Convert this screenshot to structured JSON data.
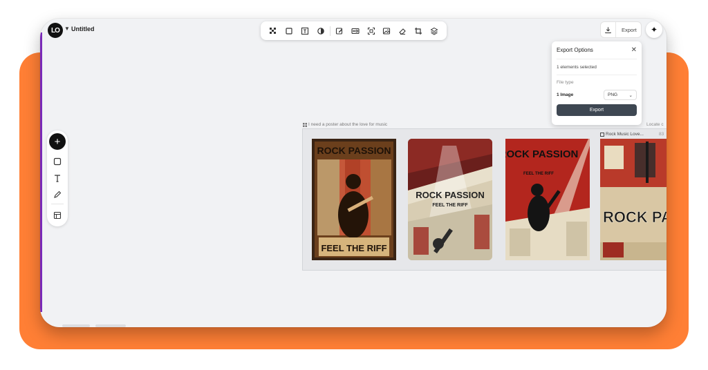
{
  "app": {
    "title": "Untitled",
    "logo": "LO"
  },
  "toolbar": {
    "tools": [
      "transparency-icon",
      "frame-icon",
      "text-box-icon",
      "adjust-icon",
      "edit-image-icon",
      "hd-icon",
      "expand-icon",
      "image-icon",
      "eraser-icon",
      "crop-icon",
      "layers-icon"
    ]
  },
  "export": {
    "button_label": "Export",
    "panel": {
      "title": "Export Options",
      "selected": "1 elements selected",
      "file_type_label": "File type",
      "row_label": "1 Image",
      "format": "PNG",
      "export_label": "Export"
    }
  },
  "rail": {
    "add": "+"
  },
  "canvas": {
    "prompt": "I need a poster about the love for music",
    "locate": "Locate c",
    "poster_label": "Rock Music Love...",
    "poster_num": "83"
  },
  "posters": [
    {
      "title": "ROCK PASSION",
      "subtitle": "FEEL THE RIFF"
    },
    {
      "title": "ROCK PASSION",
      "subtitle": "FEEL THE RIFF"
    },
    {
      "title": "ROCK PASSION",
      "subtitle": "FEEL THE RIFF"
    },
    {
      "title": "ROCK PASSION",
      "subtitle": ""
    }
  ],
  "colors": {
    "accent": "#ff7f35",
    "panel_button": "#3e4752",
    "canvas": "#f1f2f4"
  }
}
